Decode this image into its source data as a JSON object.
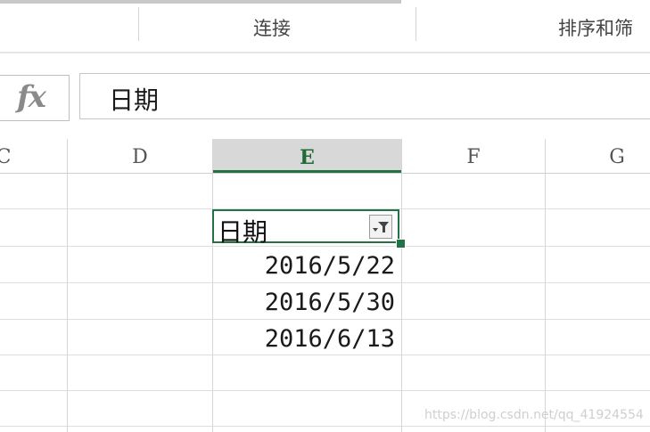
{
  "ribbon": {
    "group_connections": "连接",
    "group_sort_filter": "排序和筛"
  },
  "formula_bar": {
    "fx_label": "fx",
    "content": "日期"
  },
  "columns": {
    "c_partial": "C",
    "d": "D",
    "e": "E",
    "f": "F",
    "g": "G"
  },
  "cells": {
    "header": "日期",
    "r1": "2016/5/22",
    "r2": "2016/5/30",
    "r3": "2016/6/13"
  },
  "watermark": "https://blog.csdn.net/qq_41924554",
  "colors": {
    "selection": "#217346",
    "selected_header_bg": "#d8d8d8"
  },
  "icons": {
    "fx": "function-icon",
    "filter": "filter-dropdown-icon"
  }
}
